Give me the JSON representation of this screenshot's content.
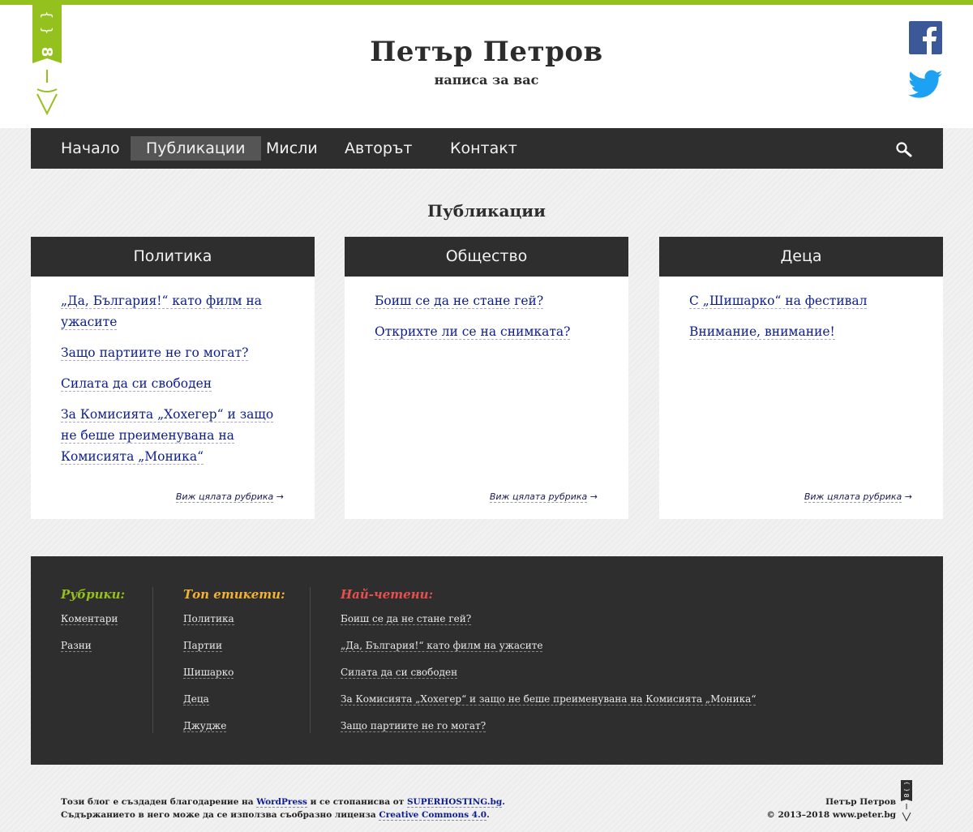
{
  "site": {
    "title": "Петър Петров",
    "subtitle": "написа за вас"
  },
  "nav": {
    "items": [
      "Начало",
      "Публикации",
      "Мисли",
      "Авторът",
      "Контакт"
    ],
    "active": "Публикации"
  },
  "page": {
    "title": "Публикации"
  },
  "categories": [
    {
      "name": "Политика",
      "posts": [
        "„Да, България!“ като филм на ужасите",
        "Защо партиите не го могат?",
        "Силата да си свободен",
        "За Комисията „Хохегер“ и защо не беше преименувана на Комисията „Моника“"
      ],
      "more": "Виж цялата рубрика"
    },
    {
      "name": "Общество",
      "posts": [
        "Боиш се да не стане гей?",
        "Открихте ли се на снимката?"
      ],
      "more": "Виж цялата рубрика"
    },
    {
      "name": "Деца",
      "posts": [
        "С „Шишарко“ на фестивал",
        "Внимание, внимание!"
      ],
      "more": "Виж цялата рубрика"
    }
  ],
  "footer": {
    "rubrics": {
      "heading": "Рубрики:",
      "color": "#95c11f",
      "items": [
        "Коментари",
        "Разни"
      ]
    },
    "tags": {
      "heading": "Топ етикети:",
      "color": "#f2b233",
      "items": [
        "Политика",
        "Партии",
        "Шишарко",
        "Деца",
        "Джудже"
      ]
    },
    "popular": {
      "heading": "Най-четени:",
      "color": "#e8504f",
      "items": [
        "Боиш се да не стане гей?",
        "„Да, България!“ като филм на ужасите",
        "Силата да си свободен",
        "За Комисията „Хохегер“ и защо не беше преименувана на Комисията „Моника“",
        "Защо партиите не го могат?"
      ]
    }
  },
  "credits": {
    "line1_a": "Този блог е създаден благодарение на ",
    "wordpress": "WordPress",
    "line1_b": " и се стопанисва от ",
    "superhosting": "SUPERHOSTING.bg",
    "line1_c": ".",
    "line2_a": "Съдържанието в него може да се използва съобразно лиценза ",
    "cc": "Creative Commons 4.0",
    "line2_b": ".",
    "author": "Петър Петров",
    "copyright": "© 2013–2018 www.peter.bg"
  },
  "colors": {
    "accent": "#95c11f",
    "dark": "#2e2e2e",
    "link": "#0c1e8f",
    "facebook": "#3b5998",
    "twitter": "#1da1f2"
  },
  "icons": {
    "logo": "logo-bookmark-icon",
    "facebook": "facebook-icon",
    "twitter": "twitter-icon",
    "search": "search-icon",
    "arrow": "arrow-right-icon"
  }
}
